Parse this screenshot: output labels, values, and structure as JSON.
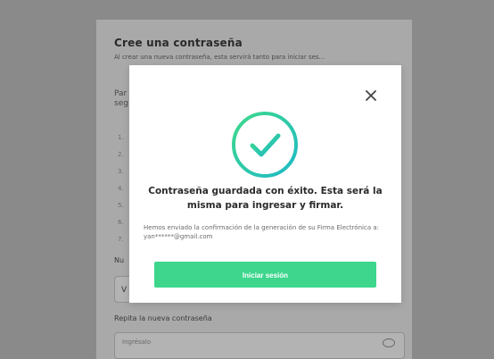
{
  "background": {
    "title": "Cree una contraseña",
    "description": "Al crear una nueva contraseña, esta servirá tanto para iniciar ses...",
    "para_line1": "Par",
    "para_line2": "seg",
    "rules": [
      "1.",
      "2.",
      "3.",
      "4.",
      "5.",
      "6.",
      "7."
    ],
    "new_password_label": "Nu",
    "new_password_value": "V",
    "repeat_label": "Repita la nueva contraseña",
    "repeat_placeholder": "Ingrésalo"
  },
  "modal": {
    "close_icon": "close-icon",
    "success_icon": "check-circle-icon",
    "accent_color": "#3dd68c",
    "message": "Contraseña guardada con éxito. Esta será la misma para ingresar y firmar.",
    "subtext": "Hemos enviado la confirmación de la generación de su Firma Electrónica a: yan******@gmail.com",
    "button_label": "Iniciar sesión"
  }
}
